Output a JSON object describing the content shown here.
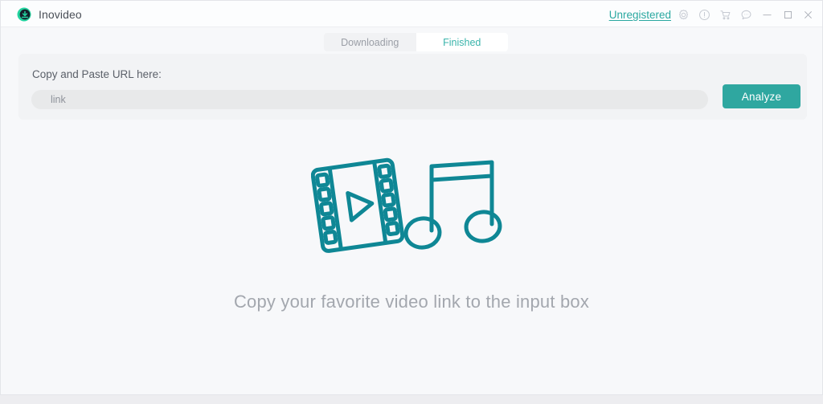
{
  "window": {
    "app_title": "Inovideo",
    "logo_icon": "download-circle-logo",
    "accent_color": "#2fa7a0",
    "logo_color": "#23d39f",
    "background_color": "#f7f8fa"
  },
  "titlebar": {
    "unregistered_label": "Unregistered",
    "icons": [
      {
        "name": "gear-icon",
        "title": "Settings"
      },
      {
        "name": "info-icon",
        "title": "Information"
      },
      {
        "name": "cart-icon",
        "title": "Store"
      },
      {
        "name": "chat-icon",
        "title": "Feedback"
      }
    ],
    "window_controls": [
      {
        "name": "minimize-icon",
        "title": "Minimize"
      },
      {
        "name": "maximize-icon",
        "title": "Maximize"
      },
      {
        "name": "close-icon",
        "title": "Close"
      }
    ]
  },
  "tabs": [
    {
      "label": "Downloading",
      "active": false
    },
    {
      "label": "Finished",
      "active": true
    }
  ],
  "url_panel": {
    "label": "Copy and Paste URL here:",
    "input_value": "",
    "input_placeholder": "link",
    "analyze_label": "Analyze"
  },
  "empty_state": {
    "illustration": "film-strip-and-music-note",
    "message": "Copy your favorite video link to the input box",
    "illustration_color": "#0f8795"
  }
}
